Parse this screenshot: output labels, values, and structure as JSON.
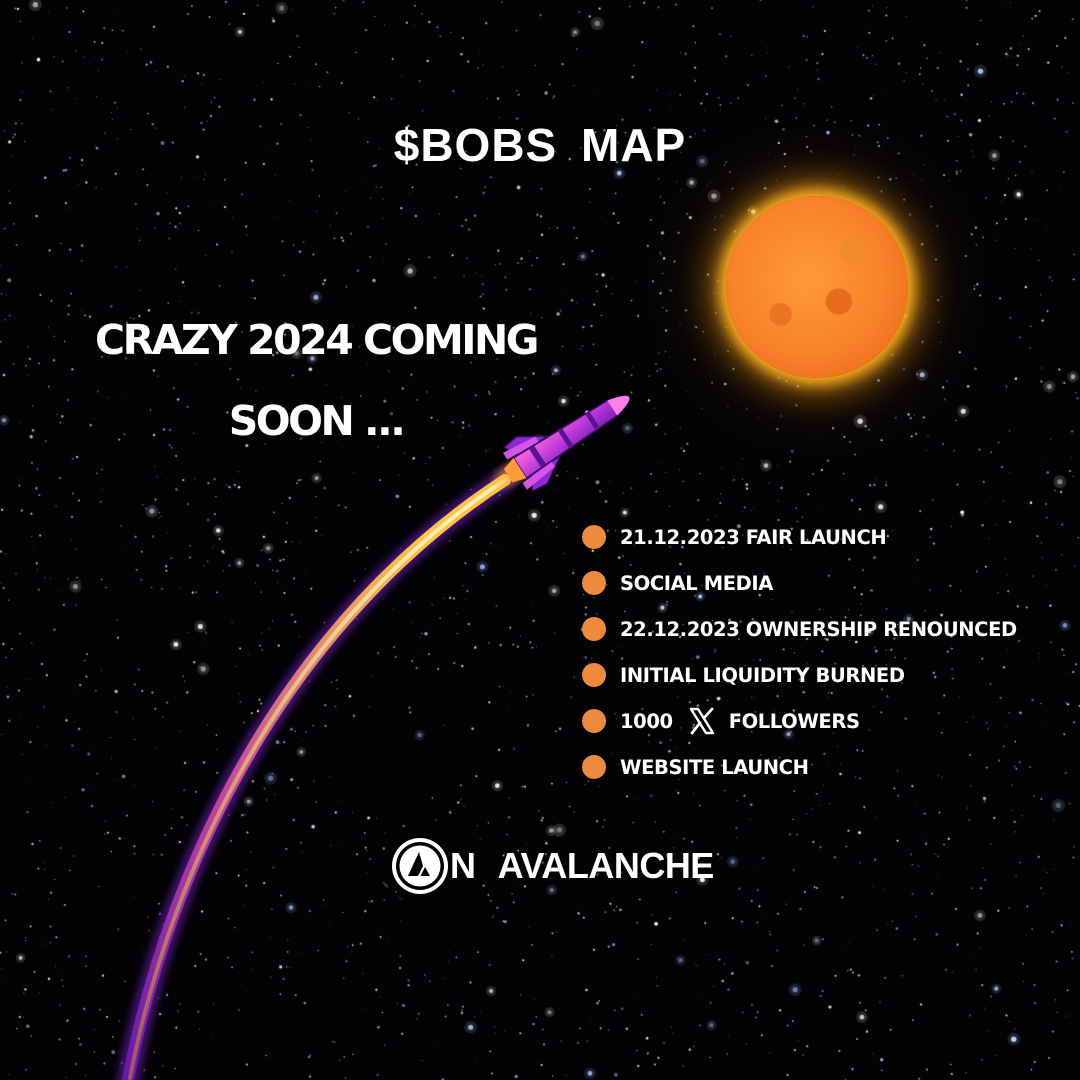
{
  "title": "$BOBS  MAP",
  "tagline": {
    "line1": "CRAZY 2024 COMING",
    "line2": "SOON ..."
  },
  "roadmap": {
    "bullet_color": "#ee8a3c",
    "items": [
      {
        "label": "21.12.2023 FAIR LAUNCH"
      },
      {
        "label": "SOCIAL MEDIA"
      },
      {
        "label": "22.12.2023 OWNERSHIP RENOUNCED"
      },
      {
        "label": "INITIAL LIQUIDITY BURNED"
      },
      {
        "label_before": "1000",
        "icon": "x-logo-icon",
        "label_after": "FOLLOWERS"
      },
      {
        "label": "WEBSITE LAUNCH"
      }
    ]
  },
  "footer": {
    "logo_icon": "avalanche-logo-icon",
    "text": "N  AVALANCHE"
  },
  "colors": {
    "background": "#030306",
    "moon": "#f7822a",
    "moon_glow": "#ffb321",
    "rocket": "#c23bd6",
    "trail": "#f0a13a",
    "text": "#ffffff"
  }
}
